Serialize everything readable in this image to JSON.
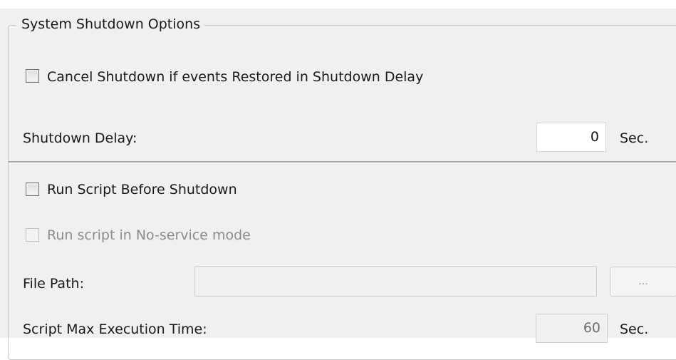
{
  "group": {
    "title": "System Shutdown Options"
  },
  "cancel_on_restore": {
    "label": "Cancel Shutdown if events Restored in Shutdown Delay",
    "checked": false
  },
  "shutdown_delay": {
    "label": "Shutdown Delay:",
    "value": "0",
    "unit": "Sec."
  },
  "run_script": {
    "label": "Run Script Before Shutdown",
    "checked": false
  },
  "no_service_mode": {
    "label": "Run script in No-service mode",
    "checked": false,
    "enabled": false
  },
  "file_path": {
    "label": "File Path:",
    "value": "",
    "browse_label": "..."
  },
  "script_max_time": {
    "label": "Script Max Execution Time:",
    "value": "60",
    "unit": "Sec."
  }
}
